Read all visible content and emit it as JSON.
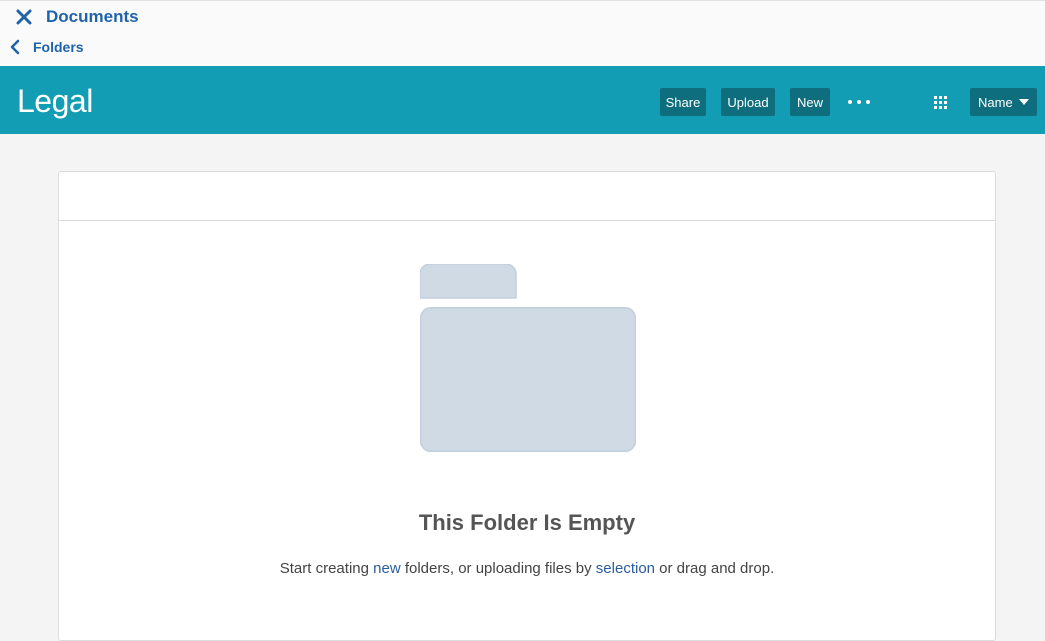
{
  "nav": {
    "close_title": "Documents",
    "back_label": "Folders"
  },
  "banner": {
    "folder_title": "Legal",
    "buttons": {
      "share": "Share",
      "upload": "Upload",
      "new": "New"
    },
    "sort_label": "Name"
  },
  "empty_state": {
    "title": "This Folder Is Empty",
    "desc_part1": "Start creating ",
    "desc_link1": "new",
    "desc_part2": " folders, or uploading files by ",
    "desc_link2": "selection",
    "desc_part3": " or drag and drop."
  },
  "colors": {
    "brand_blue": "#1f63ab",
    "banner_teal": "#129db4",
    "button_dark_teal": "#0e6e7e",
    "folder_placeholder": "#cfdae5"
  },
  "icons": {
    "close": "close-icon",
    "back": "chevron-left-icon",
    "more": "more-horizontal-icon",
    "grid": "grid-view-icon",
    "sort_caret": "caret-down-icon",
    "empty_folder": "empty-folder-icon"
  }
}
